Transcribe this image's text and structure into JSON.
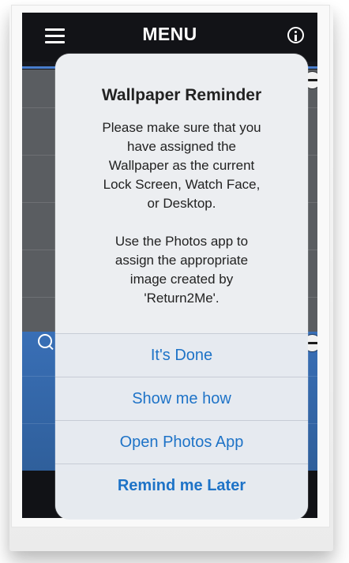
{
  "header": {
    "title": "MENU",
    "left_icon": "hamburger-icon",
    "right_icon": "info-icon"
  },
  "dialog": {
    "title": "Wallpaper Reminder",
    "message": "Please make sure that you\nhave assigned the\nWallpaper as the current\nLock Screen, Watch Face,\nor Desktop.\n\nUse the Photos app to\nassign the appropriate\nimage created by\n'Return2Me'.",
    "actions": [
      {
        "label": "It's Done"
      },
      {
        "label": "Show me how"
      },
      {
        "label": "Open Photos App"
      },
      {
        "label": "Remind me Later"
      }
    ]
  },
  "colors": {
    "accent": "#1e73c7",
    "header": "#121317",
    "blue_panel": "#396fb6"
  }
}
